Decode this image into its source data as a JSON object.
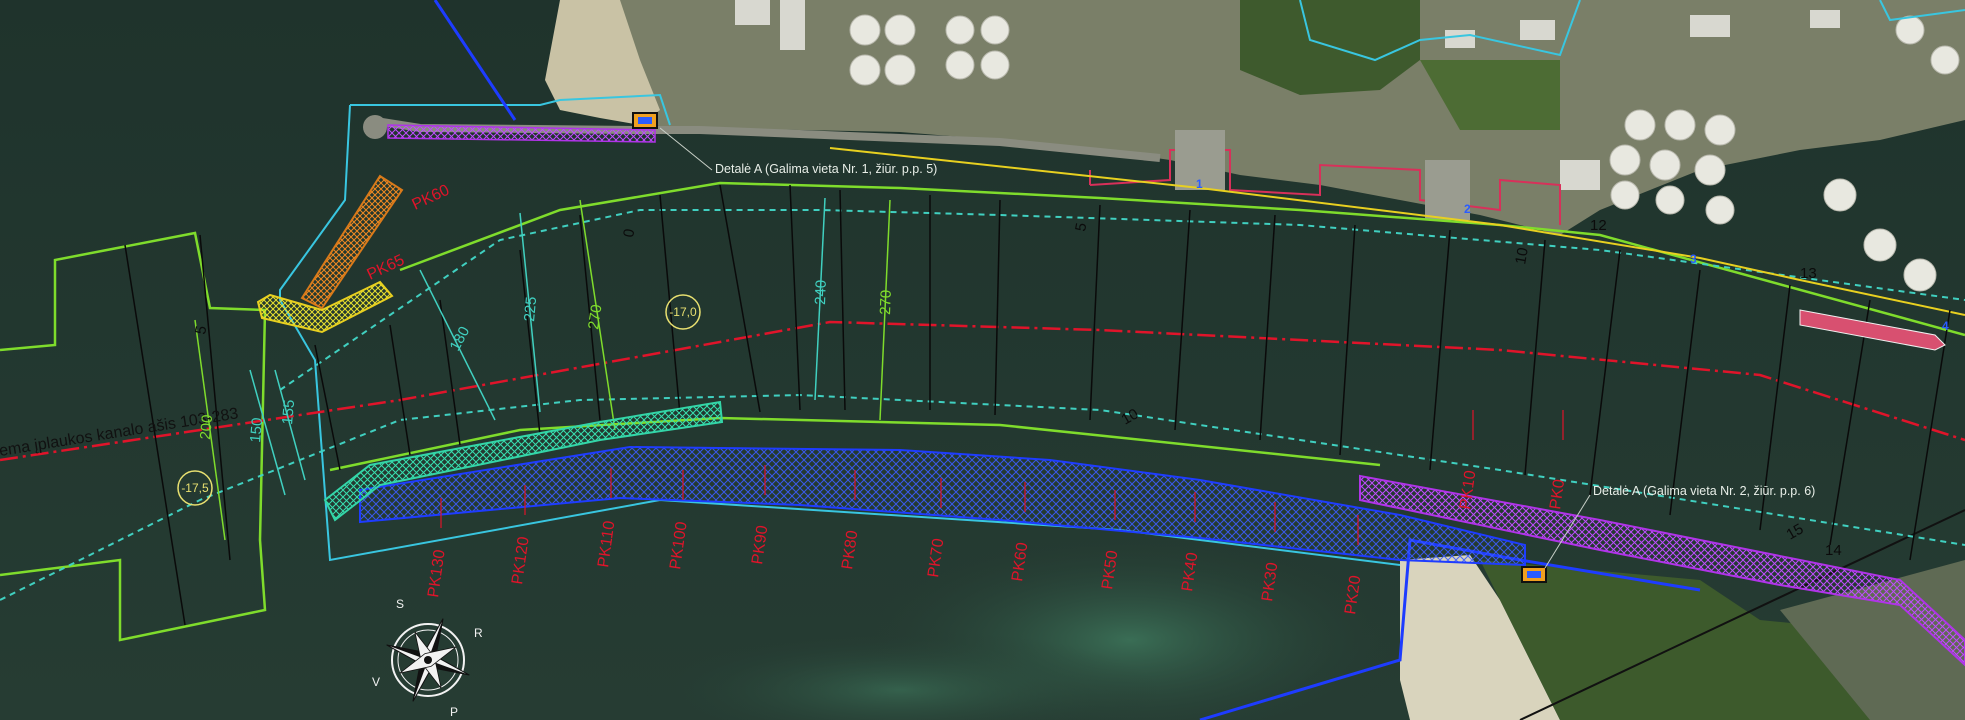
{
  "map": {
    "axis_label": "ema įplaukos kanalo ašis 103-283",
    "callouts": [
      "Detalė A (Galima vieta Nr. 1, žiūr. p.p. 5)",
      "Detalė A (Galima vieta Nr. 2, žiūr. p.p. 6)"
    ],
    "pk_labels": [
      "PK130",
      "PK120",
      "PK110",
      "PK100",
      "PK90",
      "PK80",
      "PK70",
      "PK60",
      "PK50",
      "PK40",
      "PK30",
      "PK20",
      "PK10",
      "PK0",
      "PK60",
      "PK65"
    ],
    "chainage_numbers": [
      "5",
      "0",
      "5",
      "10",
      "10",
      "15",
      "12",
      "13",
      "14"
    ],
    "dimension_labels": [
      "240",
      "270",
      "225",
      "270",
      "180",
      "150",
      "200",
      "155"
    ],
    "depth_labels": [
      "-17,0",
      "-17,5"
    ],
    "pier_numbers": [
      "1",
      "2",
      "3",
      "4"
    ],
    "compass": {
      "north": "S",
      "east": "R",
      "west": "V",
      "south": "P"
    },
    "colors": {
      "water": "#24382f",
      "channel_axis": "#e0142a",
      "channel_edge": "#7fdc2c",
      "dredge_area_blue": "#1e3cff",
      "dredge_area_purple": "#b034e8",
      "dredge_area_teal": "#33d6a8",
      "breakwater_orange": "#d97a1a",
      "dashed_cyan": "#40d0c0",
      "boundary_cyan": "#39c6e0"
    }
  }
}
